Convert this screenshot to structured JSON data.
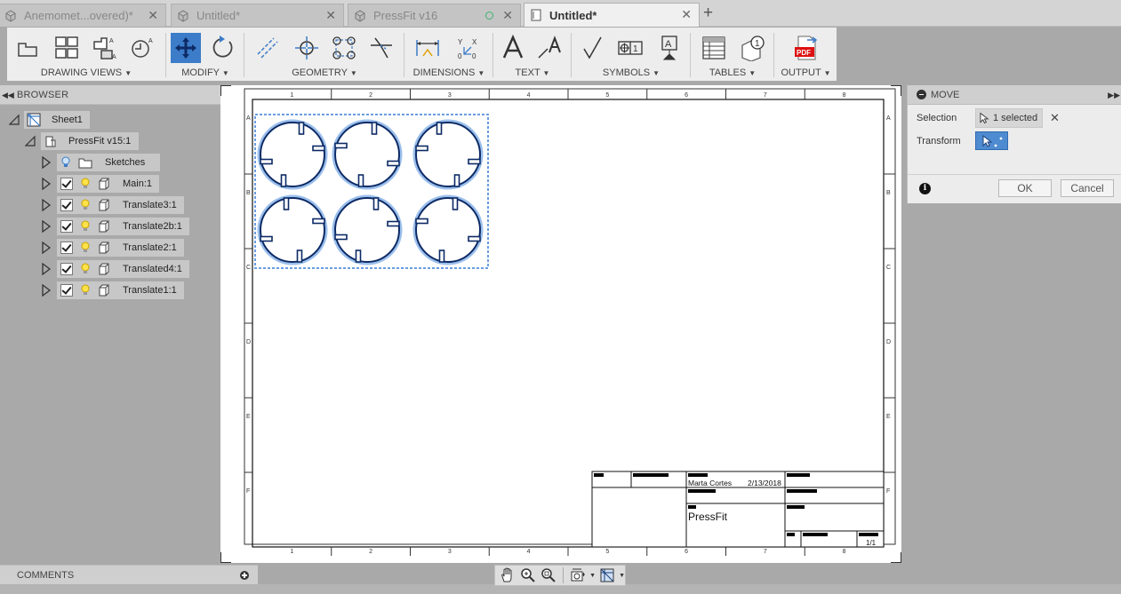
{
  "tabs": [
    {
      "label": "Anemomet...overed)*",
      "active": false
    },
    {
      "label": "Untitled*",
      "active": false
    },
    {
      "label": "PressFit v16",
      "active": false
    },
    {
      "label": "Untitled*",
      "active": true
    }
  ],
  "toolbar": {
    "groups": [
      {
        "label": "DRAWING VIEWS"
      },
      {
        "label": "MODIFY"
      },
      {
        "label": "GEOMETRY"
      },
      {
        "label": "DIMENSIONS"
      },
      {
        "label": "TEXT"
      },
      {
        "label": "SYMBOLS"
      },
      {
        "label": "TABLES"
      },
      {
        "label": "OUTPUT"
      }
    ],
    "pdf_badge": "PDF"
  },
  "browser": {
    "title": "BROWSER",
    "root": "Sheet1",
    "component": "PressFit v15:1",
    "items": [
      {
        "label": "Sketches"
      },
      {
        "label": "Main:1"
      },
      {
        "label": "Translate3:1"
      },
      {
        "label": "Translate2b:1"
      },
      {
        "label": "Translate2:1"
      },
      {
        "label": "Translated4:1"
      },
      {
        "label": "Translate1:1"
      }
    ]
  },
  "comments": {
    "title": "COMMENTS"
  },
  "sheet": {
    "column_labels": [
      "1",
      "2",
      "3",
      "4",
      "5",
      "6",
      "7",
      "8"
    ],
    "row_labels": [
      "A",
      "B",
      "C",
      "D",
      "E",
      "F"
    ],
    "title_block": {
      "author": "Marta Cortes",
      "date": "2/13/2018",
      "title": "PressFit",
      "sheet_number": "1/1"
    }
  },
  "move_dialog": {
    "title": "MOVE",
    "selection_label": "Selection",
    "selection_value": "1 selected",
    "transform_label": "Transform",
    "ok_label": "OK",
    "cancel_label": "Cancel"
  },
  "colors": {
    "accent": "#3c7cc9",
    "selection_outline": "#6a9de0",
    "part_stroke": "#0d2a66"
  }
}
